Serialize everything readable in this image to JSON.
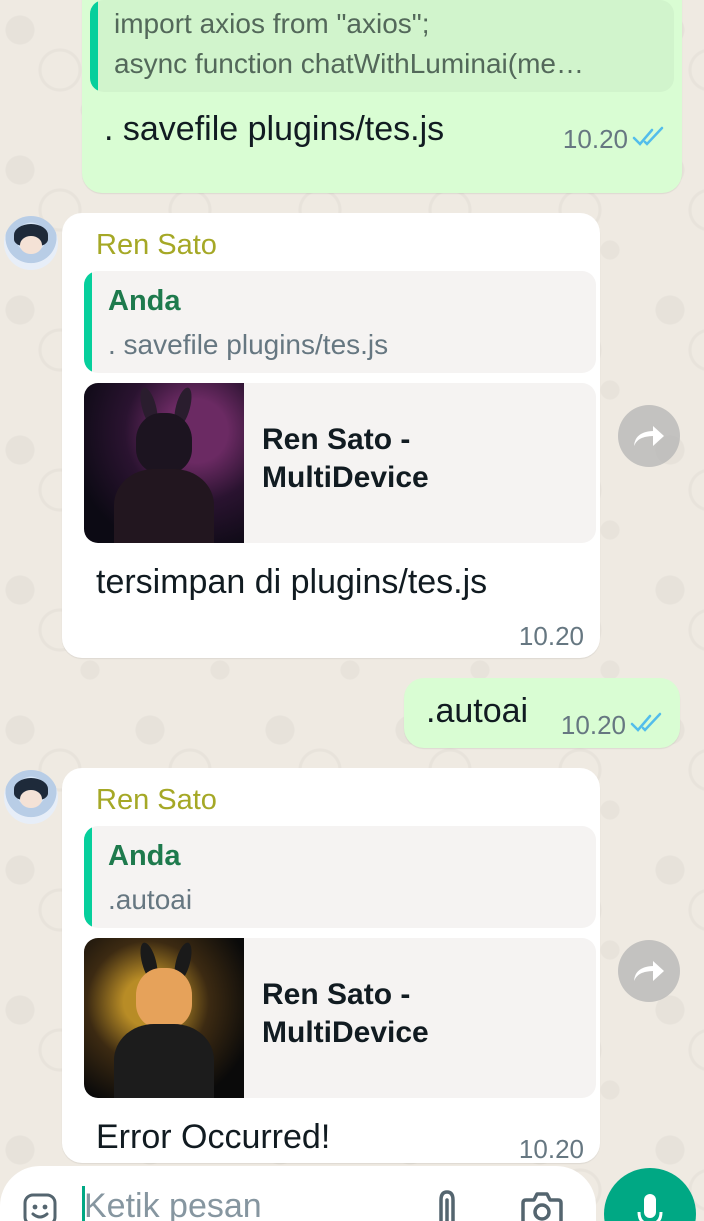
{
  "colors": {
    "outgoing_bubble": "#d9fdd3",
    "incoming_bubble": "#ffffff",
    "sender_name": "#a5a826",
    "quote_bar": "#06cf9c",
    "read_tick": "#53bdeb",
    "accent": "#00a884"
  },
  "messages": [
    {
      "direction": "outgoing",
      "quoted_lines": [
        "import axios from \"axios\";",
        "async function chatWithLuminai(me…"
      ],
      "text": ". savefile plugins/tes.js",
      "time": "10.20",
      "status_icon": "double-check-read-icon"
    },
    {
      "direction": "incoming",
      "sender": "Ren Sato",
      "quote": {
        "name": "Anda",
        "text": ". savefile plugins/tes.js"
      },
      "preview_title": "Ren Sato - MultiDevice",
      "text": "tersimpan di plugins/tes.js",
      "time": "10.20"
    },
    {
      "direction": "outgoing",
      "text": ".autoai",
      "time": "10.20",
      "status_icon": "double-check-read-icon"
    },
    {
      "direction": "incoming",
      "sender": "Ren Sato",
      "quote": {
        "name": "Anda",
        "text": ".autoai"
      },
      "preview_title": "Ren Sato - MultiDevice",
      "text": "Error Occurred!",
      "time": "10.20"
    }
  ],
  "composer": {
    "placeholder": "Ketik pesan",
    "icons": [
      "emoji-icon",
      "attach-icon",
      "camera-icon",
      "mic-icon"
    ]
  }
}
